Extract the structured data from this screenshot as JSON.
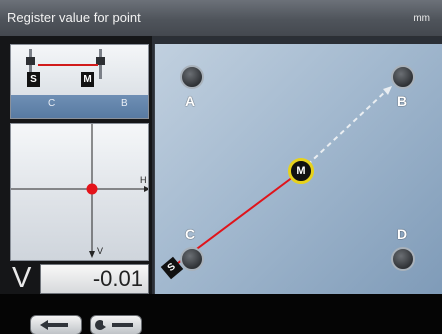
{
  "header": {
    "title": "Register value for point",
    "units": "mm"
  },
  "thumbnail": {
    "labels": [
      "C",
      "B"
    ],
    "units": [
      "S",
      "M"
    ]
  },
  "graph": {
    "h_label": "H",
    "v_label": "V"
  },
  "readout": {
    "axis": "V",
    "value": "-0.01"
  },
  "points": [
    "A",
    "B",
    "C",
    "D"
  ],
  "badges": {
    "moving": "M",
    "stationary": "S"
  },
  "footer": {
    "back_icon": "arrow-left-icon",
    "tool_icon": "wrench-icon"
  }
}
